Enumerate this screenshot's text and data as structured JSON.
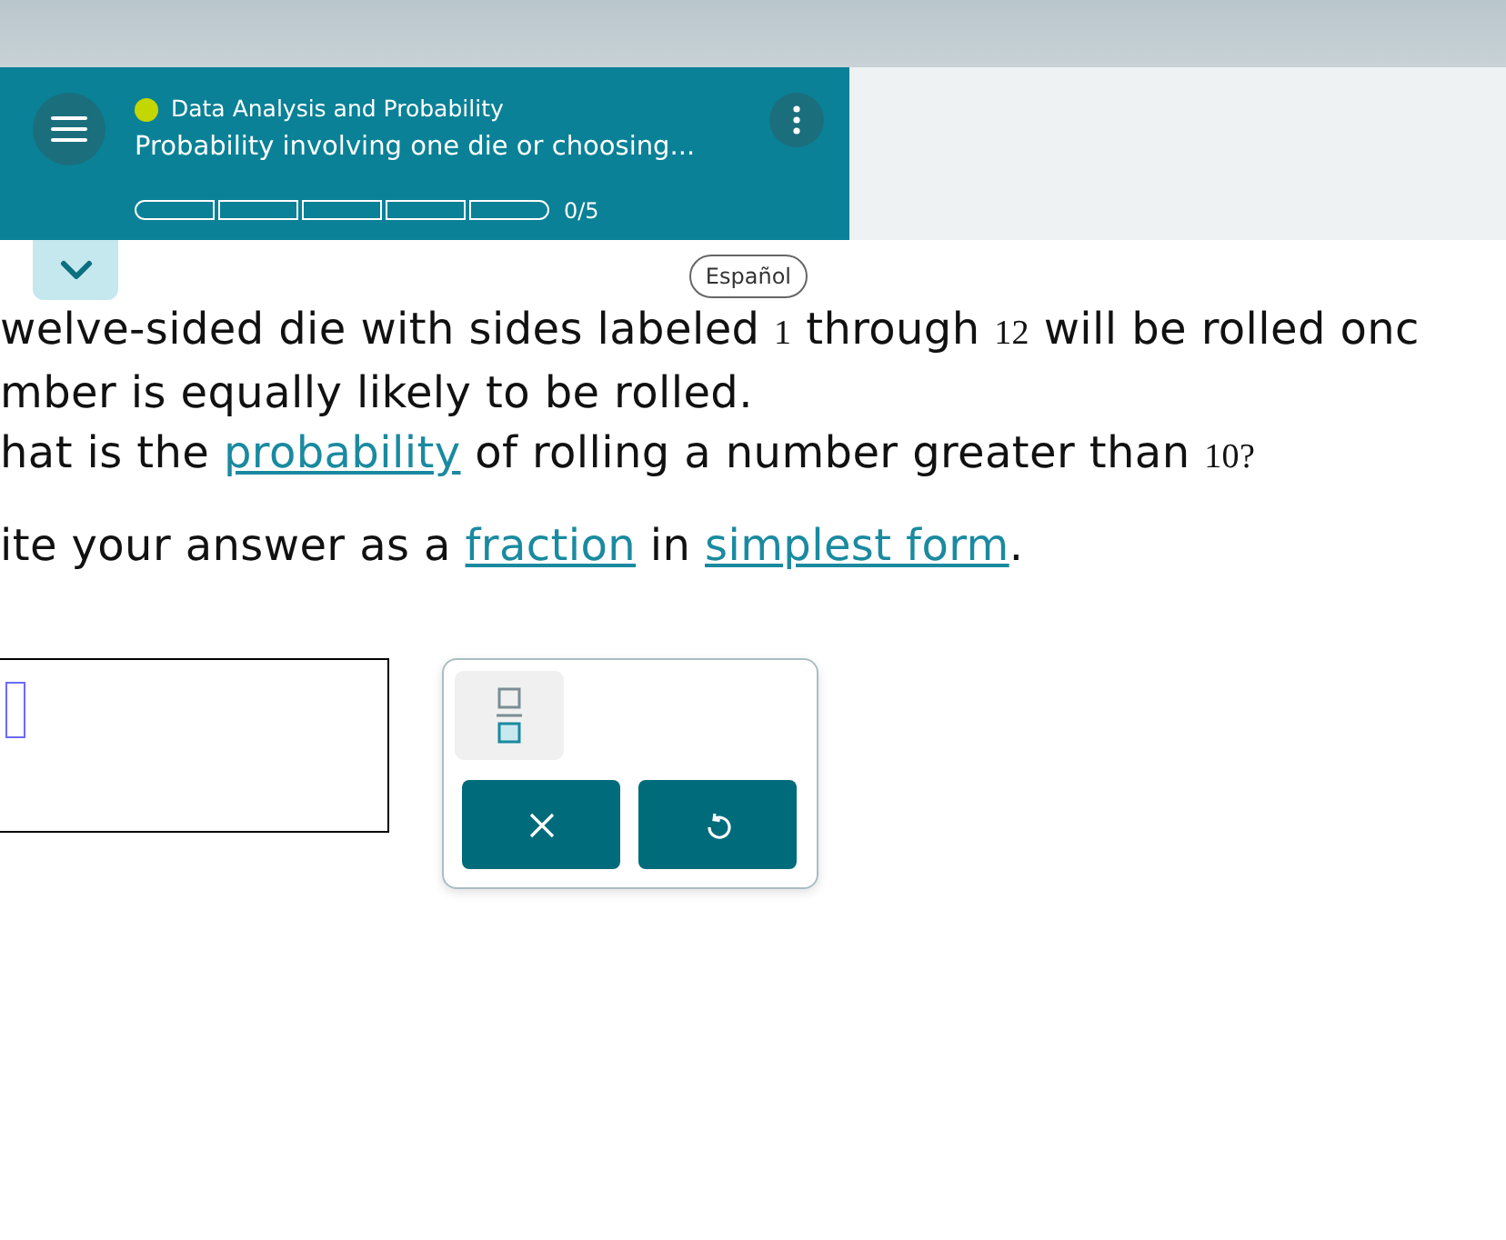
{
  "header": {
    "topic": {
      "label": "Data Analysis and Probability",
      "color": "#c4d600"
    },
    "title": "Probability involving one die or choosing...",
    "progress": {
      "segments": [
        {
          "filled": false
        },
        {
          "filled": false
        },
        {
          "filled": false
        },
        {
          "filled": false
        },
        {
          "filled": false
        }
      ],
      "label": "0/5"
    }
  },
  "language_button": "Español",
  "question": [
    [
      {
        "kind": "text",
        "text": "welve-sided die with sides labeled "
      },
      {
        "kind": "math",
        "text": "1"
      },
      {
        "kind": "text",
        "text": " through "
      },
      {
        "kind": "math",
        "text": "12"
      },
      {
        "kind": "text",
        "text": " will be rolled onc"
      }
    ],
    [
      {
        "kind": "text",
        "text": "mber is equally likely to be rolled."
      }
    ],
    [
      {
        "kind": "text",
        "text": "hat is the "
      },
      {
        "kind": "link",
        "text": "probability"
      },
      {
        "kind": "text",
        "text": " of rolling a number greater than "
      },
      {
        "kind": "math",
        "text": "10?"
      }
    ],
    [
      {
        "kind": "text",
        "text": "ite your answer as a "
      },
      {
        "kind": "link",
        "text": "fraction"
      },
      {
        "kind": "text",
        "text": " in "
      },
      {
        "kind": "link",
        "text": "simplest form"
      },
      {
        "kind": "text",
        "text": "."
      }
    ]
  ],
  "keypad": {
    "keys": [
      {
        "kind": "fraction"
      }
    ],
    "actions": [
      {
        "kind": "clear"
      },
      {
        "kind": "undo"
      }
    ]
  }
}
